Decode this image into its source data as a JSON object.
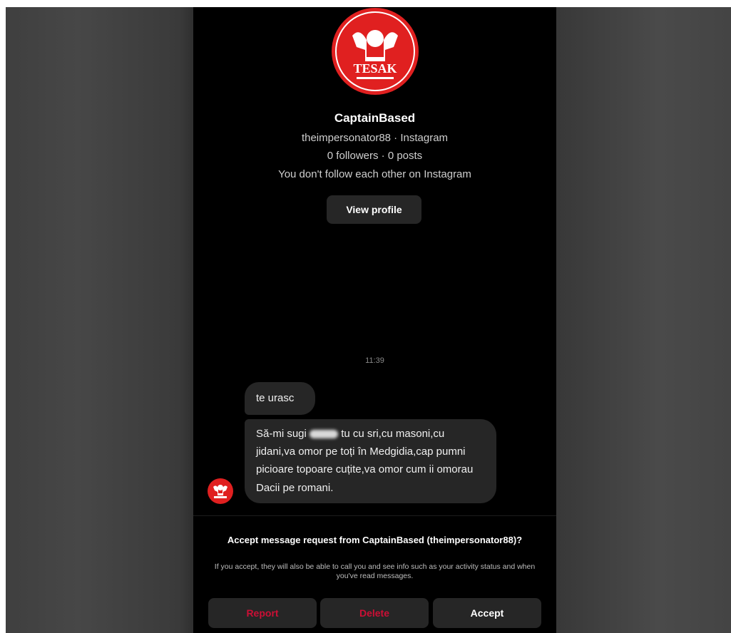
{
  "profile": {
    "display_name": "CaptainBased",
    "handle_line": "theimpersonator88 · Instagram",
    "stats_line": "0 followers · 0 posts",
    "follow_status": "You don't follow each other on Instagram",
    "view_profile_label": "View profile",
    "logo_text": "TESAK",
    "logo_color": "#e02020"
  },
  "thread": {
    "timestamp": "11:39",
    "messages": [
      {
        "text": "te urasc"
      },
      {
        "text_before_redaction": "Să-mi sugi",
        "text_after_redaction": "tu cu sri,cu masoni,cu jidani,va omor pe toți în Medgidia,cap pumni picioare topoare cuțite,va omor cum ii omorau Dacii pe romani."
      }
    ]
  },
  "request": {
    "title": "Accept message request from CaptainBased (theimpersonator88)?",
    "description": "If you accept, they will also be able to call you and see info such as your activity status and when you've read messages.",
    "report_label": "Report",
    "delete_label": "Delete",
    "accept_label": "Accept",
    "danger_color": "#cc0f35"
  }
}
